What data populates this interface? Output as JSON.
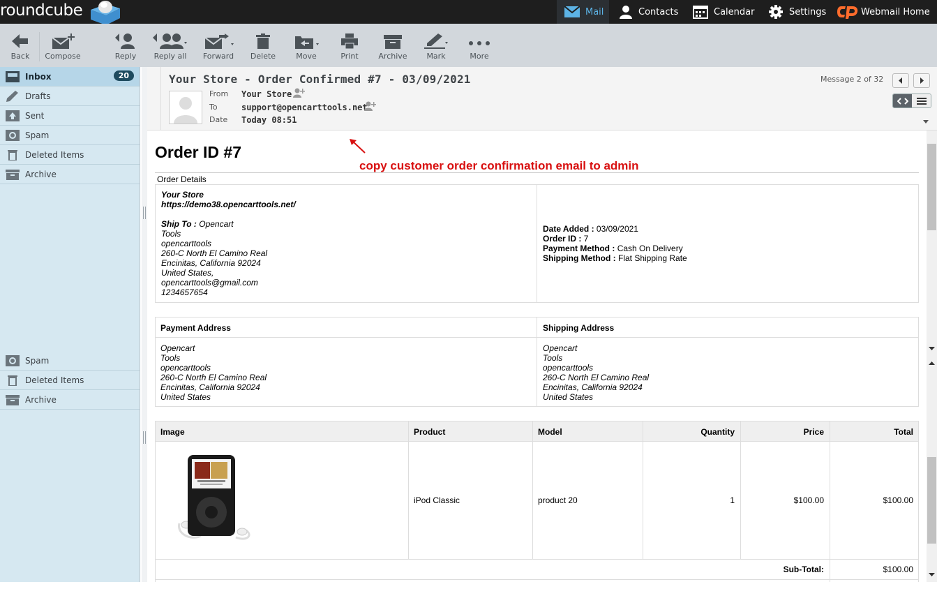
{
  "app": {
    "logo_text": "roundcube"
  },
  "topnav": {
    "mail": "Mail",
    "contacts": "Contacts",
    "calendar": "Calendar",
    "settings": "Settings",
    "webmail_home": "Webmail Home"
  },
  "toolbar": {
    "back": "Back",
    "compose": "Compose",
    "reply": "Reply",
    "reply_all": "Reply all",
    "forward": "Forward",
    "delete": "Delete",
    "move": "Move",
    "print": "Print",
    "archive": "Archive",
    "mark": "Mark",
    "more": "More"
  },
  "sidebar": {
    "folders": [
      {
        "label": "Inbox",
        "unread": "20"
      },
      {
        "label": "Drafts"
      },
      {
        "label": "Sent"
      },
      {
        "label": "Spam"
      },
      {
        "label": "Deleted Items"
      },
      {
        "label": "Archive"
      }
    ],
    "folders_lower": [
      {
        "label": "Spam"
      },
      {
        "label": "Deleted Items"
      },
      {
        "label": "Archive"
      }
    ]
  },
  "message": {
    "subject": "Your Store - Order Confirmed #7 - 03/09/2021",
    "from_label": "From",
    "from_value": "Your Store",
    "to_label": "To",
    "to_value": "support@opencarttools.net",
    "date_label": "Date",
    "date_value": "Today 08:51",
    "counter": "Message 2 of 32"
  },
  "body": {
    "order_title": "Order ID #7",
    "annotation": "copy customer order confirmation email to admin",
    "order_details_label": "Order Details",
    "store_name": "Your Store",
    "store_url": "https://demo38.opencarttools.net/",
    "ship_to_label": "Ship To :",
    "ship_to_lines": [
      "Opencart",
      "Tools",
      "opencarttools",
      "260-C North El Camino Real",
      "Encinitas, California 92024",
      "United States,",
      "opencarttools@gmail.com",
      "1234657654"
    ],
    "date_added_label": "Date Added :",
    "date_added": "03/09/2021",
    "order_id_label": "Order ID :",
    "order_id": "7",
    "payment_method_label": "Payment Method :",
    "payment_method": "Cash On Delivery",
    "shipping_method_label": "Shipping Method :",
    "shipping_method": "Flat Shipping Rate",
    "payment_address_label": "Payment Address",
    "shipping_address_label": "Shipping Address",
    "payment_address_lines": [
      "Opencart",
      "Tools",
      "opencarttools",
      "260-C North El Camino Real",
      "Encinitas, California 92024",
      "United States"
    ],
    "shipping_address_lines": [
      "Opencart",
      "Tools",
      "opencarttools",
      "260-C North El Camino Real",
      "Encinitas, California 92024",
      "United States"
    ],
    "products": {
      "headers": [
        "Image",
        "Product",
        "Model",
        "Quantity",
        "Price",
        "Total"
      ],
      "rows": [
        {
          "product": "iPod Classic",
          "model": "product 20",
          "quantity": "1",
          "price": "$100.00",
          "total": "$100.00"
        }
      ],
      "subtotal_label": "Sub-Total:",
      "subtotal": "$100.00"
    }
  },
  "colors": {
    "accent": "#5cb3e6",
    "topbar": "#1e1e1e",
    "sidebar": "#d6e8f1",
    "annotation": "#d81010"
  }
}
